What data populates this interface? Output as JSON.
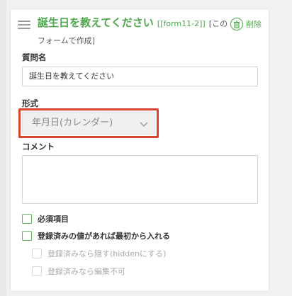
{
  "question": {
    "title": "誕生日を教えてください",
    "form_ref": "[[form11-2]]",
    "note": "[このフォームで作成]",
    "delete_label": "削除"
  },
  "fields": {
    "question_name_label": "質問名",
    "question_name_value": "誕生日を教えてください",
    "format_label": "形式",
    "format_value": "年月日(カレンダー)",
    "comment_label": "コメント",
    "comment_value": ""
  },
  "options": {
    "required_label": "必須項目",
    "prefill_label": "登録済みの値があれば最初から入れる",
    "hide_label": "登録済みなら隠す(hiddenにする)",
    "noedit_label": "登録済みなら編集不可"
  },
  "colors": {
    "accent": "#4fa64f",
    "highlight": "#d9442e",
    "checkbox": "#5cb85c"
  },
  "icons": {
    "handle": "drag-handle-icon",
    "delete": "trash-icon",
    "select": "chevron-down-icon",
    "resize": "resize-grip-icon"
  }
}
